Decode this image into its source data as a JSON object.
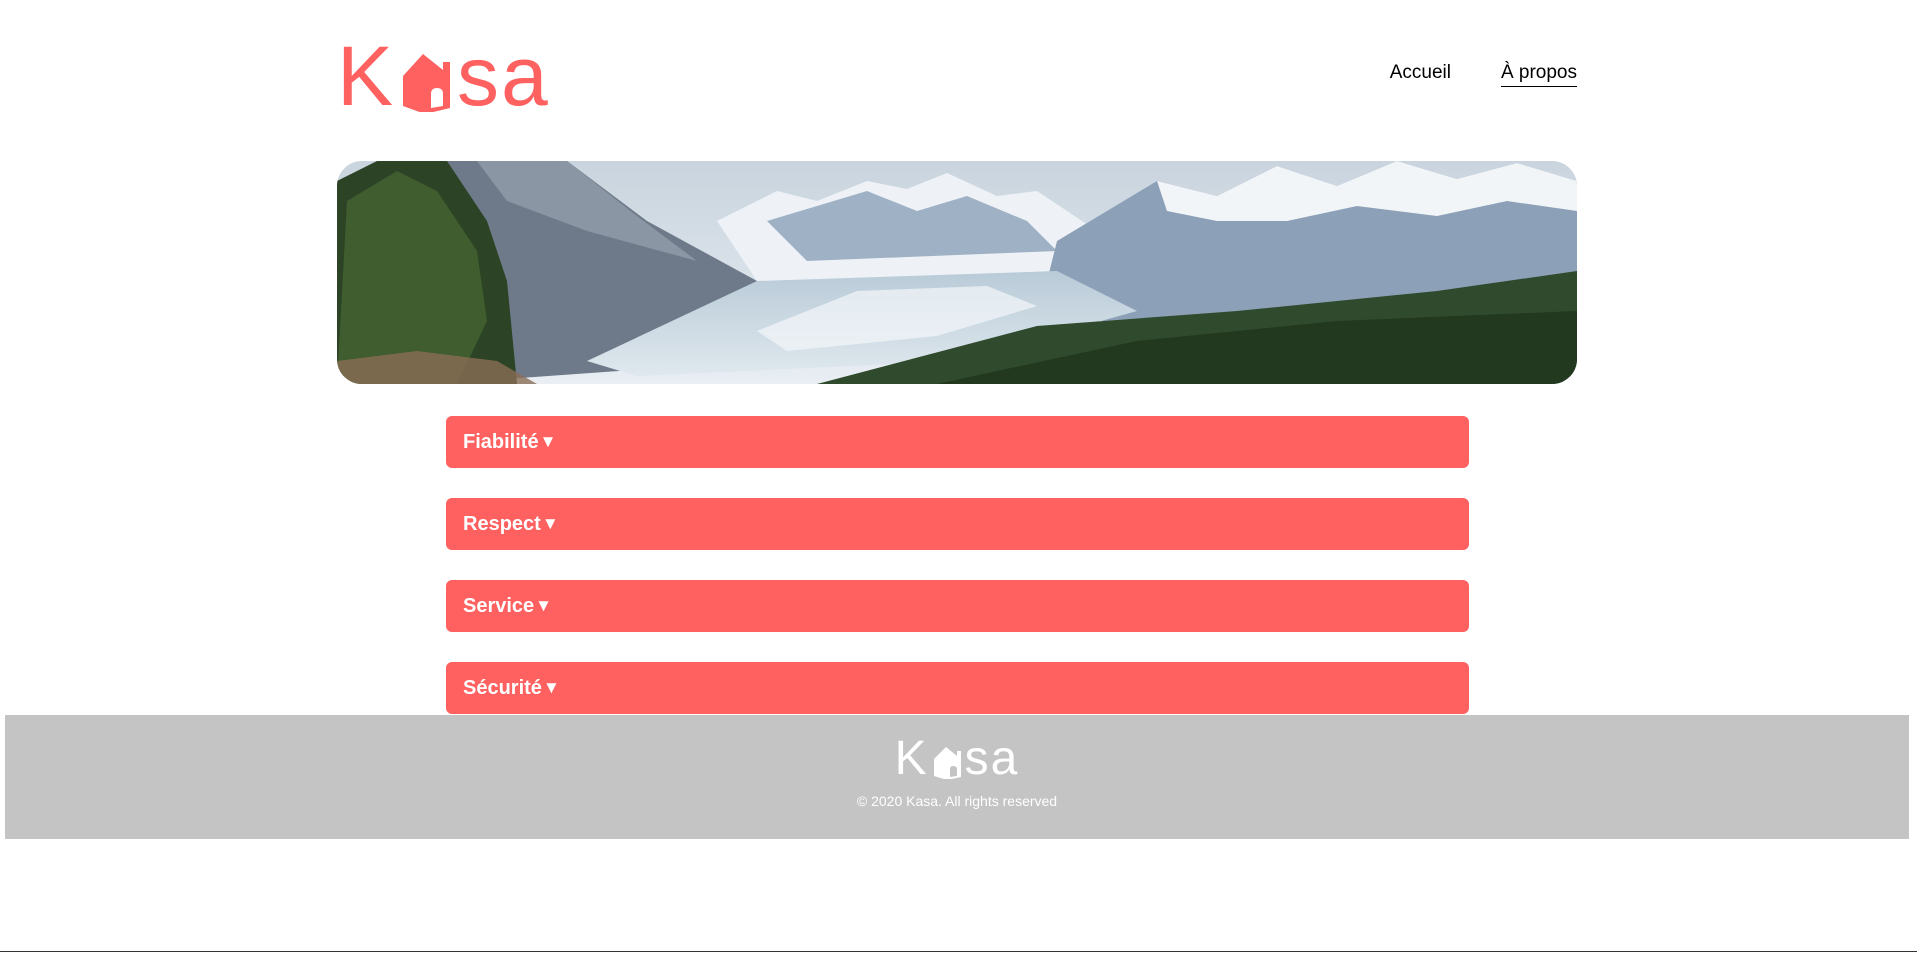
{
  "header": {
    "logo": {
      "text_before": "K",
      "text_after": "sa",
      "icon": "house-icon"
    },
    "nav": [
      {
        "label": "Accueil",
        "active": false
      },
      {
        "label": "À propos",
        "active": true
      }
    ]
  },
  "banner": {
    "image": "mountain-landscape-image"
  },
  "collapses": [
    {
      "title": "Fiabilité",
      "arrow": "▼"
    },
    {
      "title": "Respect",
      "arrow": "▼"
    },
    {
      "title": "Service",
      "arrow": "▼"
    },
    {
      "title": "Sécurité",
      "arrow": "▼"
    }
  ],
  "footer": {
    "logo": {
      "text_before": "K",
      "text_after": "sa",
      "icon": "house-icon"
    },
    "copyright": "© 2020 Kasa. All rights reserved"
  },
  "colors": {
    "brand": "#ff6060",
    "footer_bg": "#c4c4c4",
    "text": "#000000",
    "white": "#ffffff"
  }
}
